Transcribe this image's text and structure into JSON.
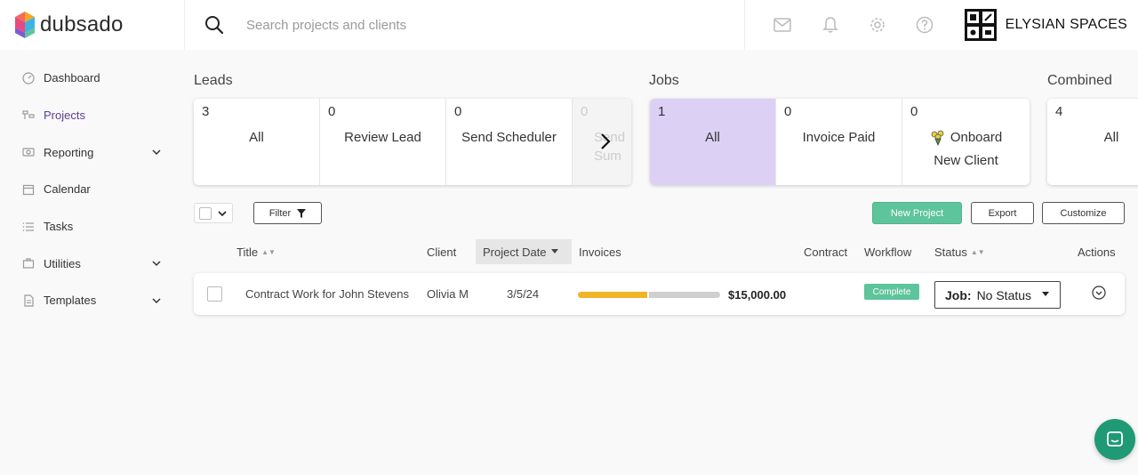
{
  "app": {
    "logo_text": "dubsado"
  },
  "search": {
    "placeholder": "Search projects and clients"
  },
  "brand": {
    "name": "ELYSIAN SPACES"
  },
  "sidebar": {
    "items": [
      {
        "label": "Dashboard",
        "icon": "dashboard-icon"
      },
      {
        "label": "Projects",
        "icon": "projects-icon",
        "active": true
      },
      {
        "label": "Reporting",
        "icon": "reporting-icon",
        "expandable": true
      },
      {
        "label": "Calendar",
        "icon": "calendar-icon"
      },
      {
        "label": "Tasks",
        "icon": "tasks-icon"
      },
      {
        "label": "Utilities",
        "icon": "utilities-icon",
        "expandable": true
      },
      {
        "label": "Templates",
        "icon": "templates-icon",
        "expandable": true
      }
    ]
  },
  "sections": {
    "leads": "Leads",
    "jobs": "Jobs",
    "combined": "Combined"
  },
  "leads_cards": [
    {
      "count": "3",
      "label": "All"
    },
    {
      "count": "0",
      "label": "Review Lead"
    },
    {
      "count": "0",
      "label": "Send Scheduler"
    },
    {
      "count": "0",
      "label": "Send\nSum"
    }
  ],
  "jobs_cards": [
    {
      "count": "1",
      "label": "All",
      "selected": true
    },
    {
      "count": "0",
      "label": "Invoice Paid"
    },
    {
      "count": "0",
      "label": "Onboard New Client",
      "label_line1": "Onboard",
      "label_line2": "New Client"
    }
  ],
  "combined_cards": [
    {
      "count": "4",
      "label": "All"
    }
  ],
  "toolbar": {
    "filter_label": "Filter",
    "new_project_label": "New Project",
    "export_label": "Export",
    "customize_label": "Customize"
  },
  "table": {
    "headers": {
      "title": "Title",
      "client": "Client",
      "project_date": "Project Date",
      "invoices": "Invoices",
      "contract": "Contract",
      "workflow": "Workflow",
      "status": "Status",
      "actions": "Actions"
    },
    "rows": [
      {
        "title": "Contract Work for John Stevens",
        "client": "Olivia M",
        "project_date": "3/5/24",
        "invoice_paid_fraction": 0.49,
        "invoice_amount": "$15,000.00",
        "workflow": "Complete",
        "status_prefix": "Job:",
        "status_value": "No Status"
      }
    ]
  },
  "colors": {
    "accent_green": "#5ec49c",
    "selected_card": "#dcd0f4",
    "progress_paid": "#f0b428",
    "chat": "#1f9a74"
  }
}
